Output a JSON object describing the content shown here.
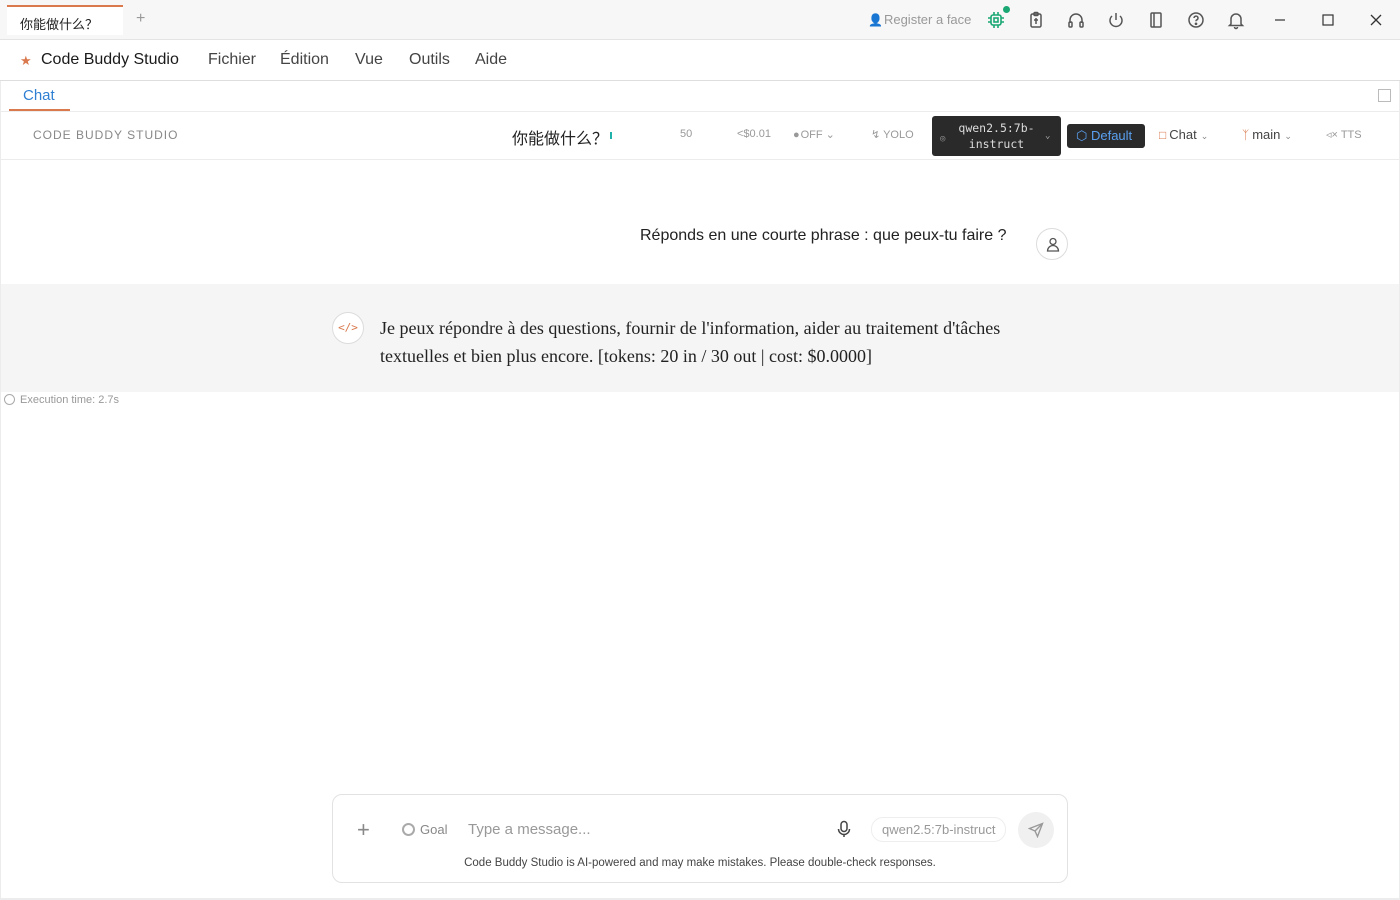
{
  "window": {
    "tab_title": "你能做什么？",
    "new_tab": "+",
    "register_face": "Register a face",
    "icons": [
      "ai-chip-icon",
      "clipboard-icon",
      "headset-icon",
      "power-icon",
      "book-icon",
      "help-icon",
      "bell-icon"
    ],
    "status_dot_color": "#1aa774"
  },
  "menubar": {
    "app_name": "Code Buddy Studio",
    "items": [
      "Fichier",
      "Édition",
      "Vue",
      "Outils",
      "Aide"
    ]
  },
  "panel": {
    "tab_label": "Chat"
  },
  "toolbar": {
    "brand": "CODE BUDDY STUDIO",
    "conversation_title": "你能做什么？",
    "token_count": "50",
    "cost": "<$0.01",
    "thinking": "OFF",
    "yolo": "YOLO",
    "model_line1": "qwen2.5:7b-",
    "model_line2": "instruct",
    "mode": "Default",
    "chat_mode": "Chat",
    "branch": "main",
    "tts": "TTS"
  },
  "conversation": {
    "user_message": "Réponds en une courte phrase : que peux-tu faire ?",
    "assistant_message": "Je peux répondre à des questions, fournir de l'information, aider au traitement d'tâches textuelles et bien plus encore. [tokens: 20 in / 30 out | cost: $0.0000]",
    "execution_time": "Execution time: 2.7s"
  },
  "composer": {
    "goal_label": "Goal",
    "placeholder": "Type a message...",
    "model_chip": "qwen2.5:7b-instruct",
    "disclaimer": "Code Buddy Studio is AI-powered and may make mistakes. Please double-check responses."
  },
  "colors": {
    "accent": "#d9794d",
    "link_blue": "#2f7fd3"
  }
}
